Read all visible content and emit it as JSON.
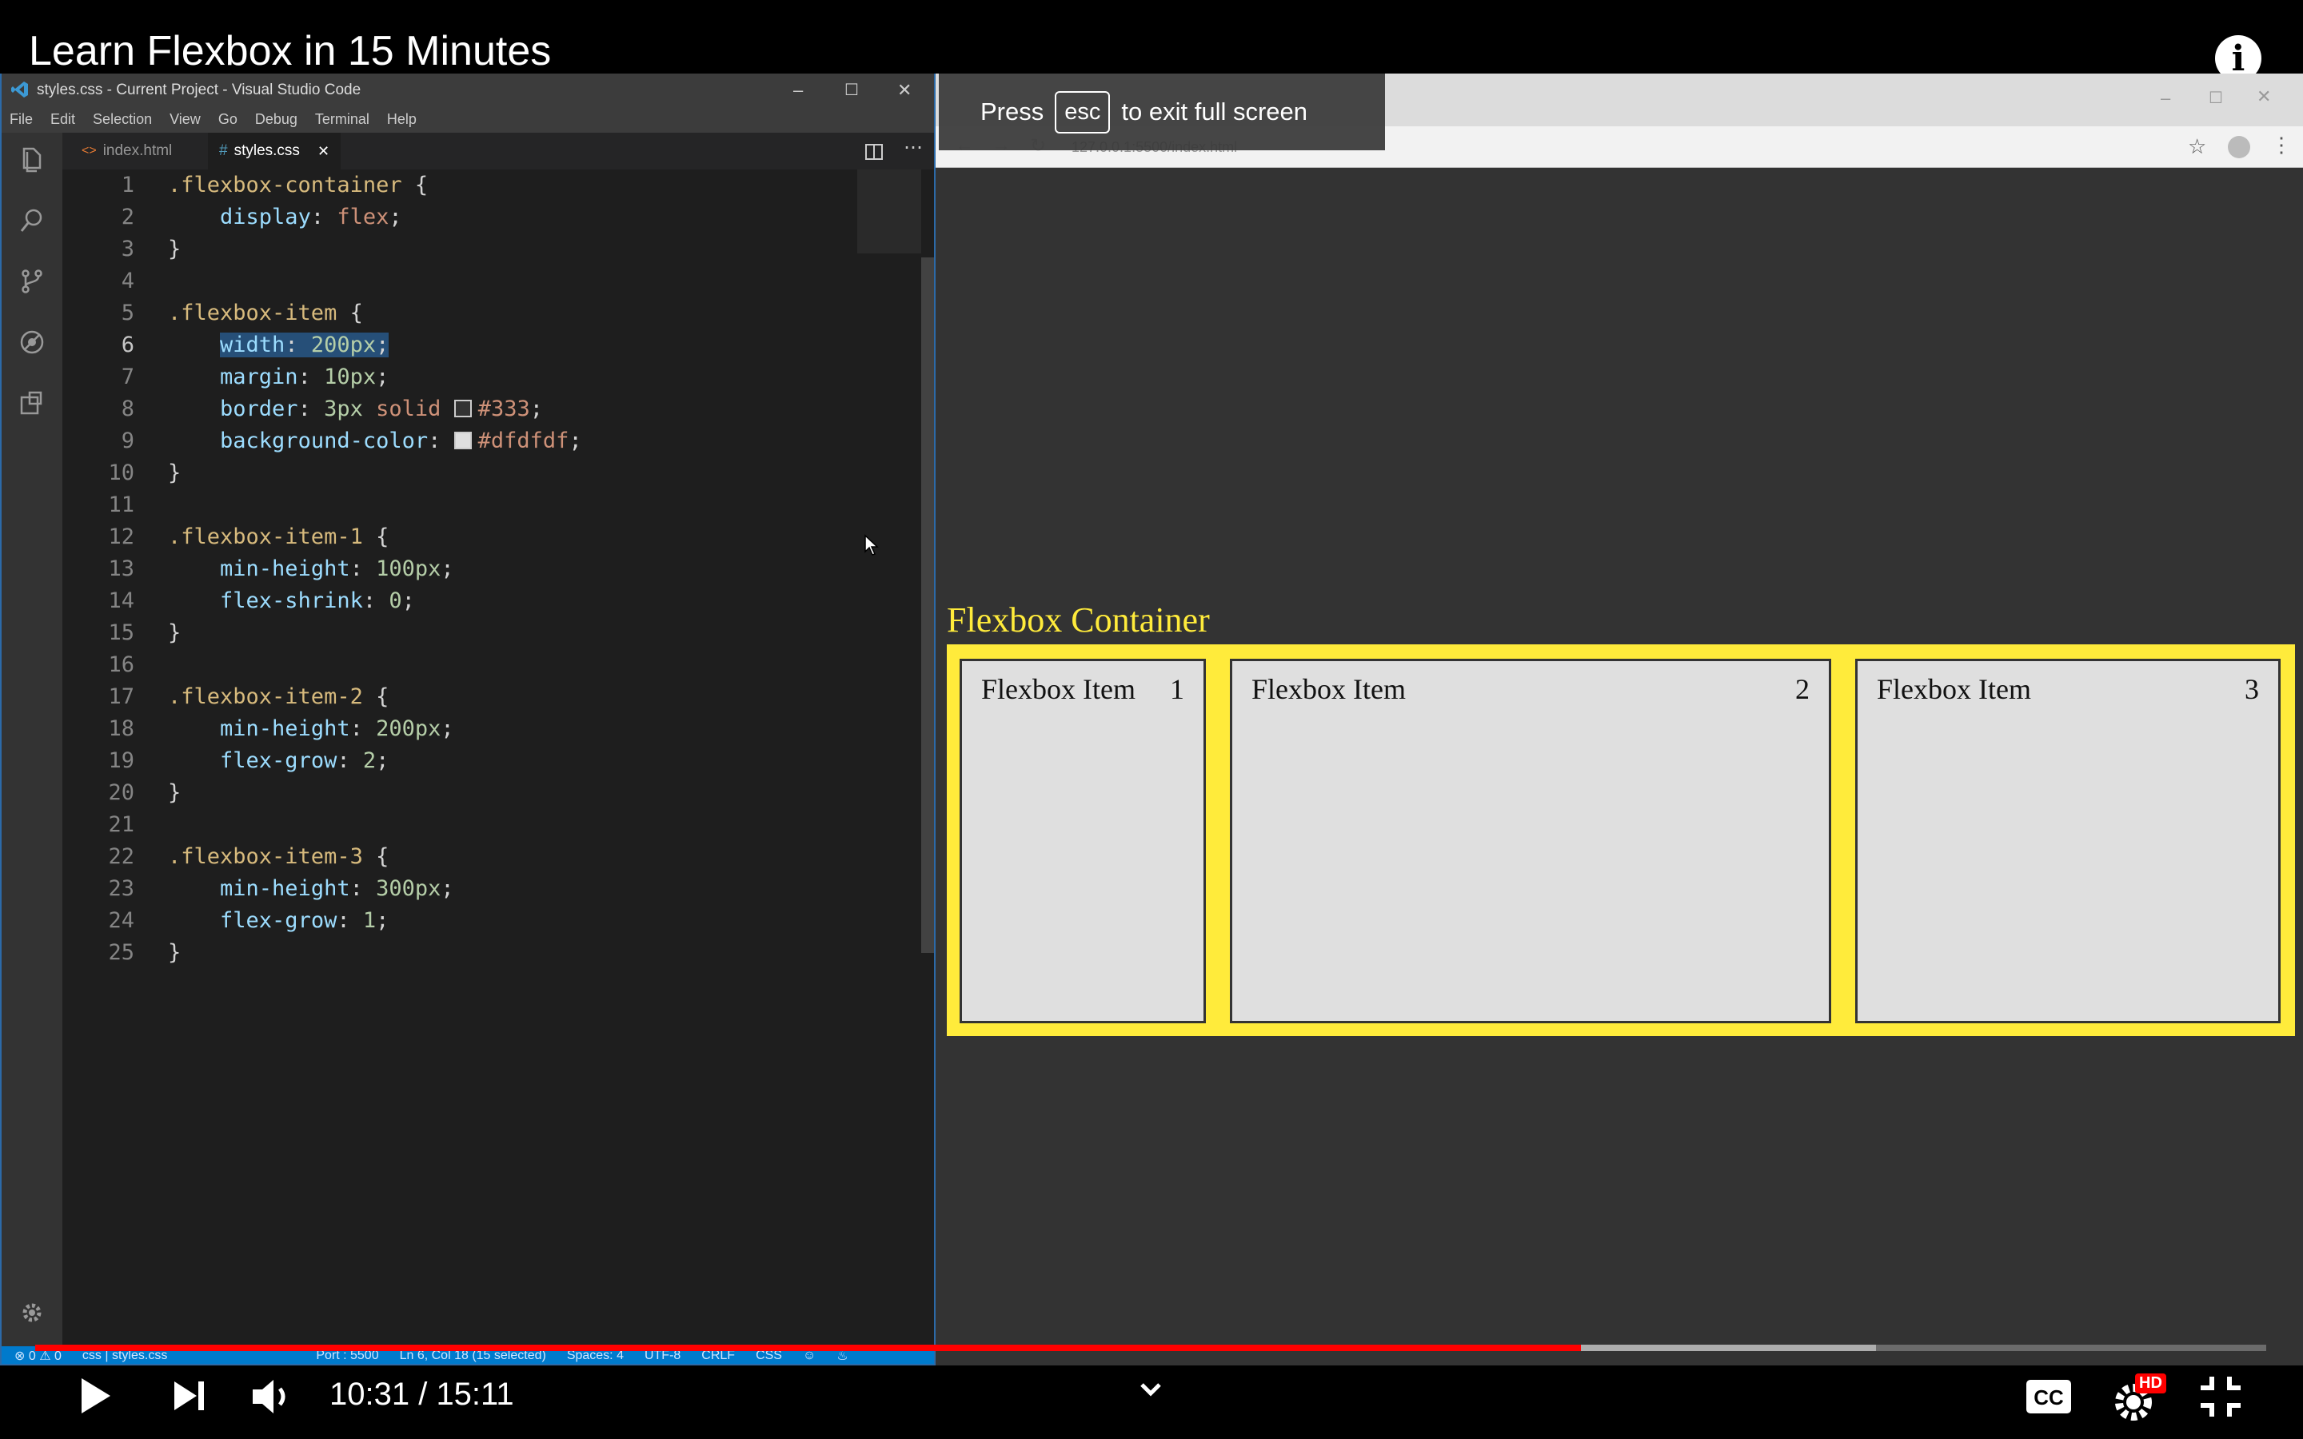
{
  "video": {
    "title": "Learn Flexbox in 15 Minutes",
    "time_display": "10:31 / 15:11",
    "progress_fraction": 0.6929,
    "buffered_fraction": 0.825,
    "info_label": "i",
    "hd_badge": "HD"
  },
  "fullscreen_toast": {
    "press": "Press",
    "key": "esc",
    "rest": "to exit full screen"
  },
  "vscode": {
    "window_title": "styles.css - Current Project - Visual Studio Code",
    "menu": [
      "File",
      "Edit",
      "Selection",
      "View",
      "Go",
      "Debug",
      "Terminal",
      "Help"
    ],
    "tabs": [
      {
        "label": "index.html",
        "icon": "<>"
      },
      {
        "label": "styles.css",
        "icon": "#"
      }
    ],
    "status": {
      "errors": "0",
      "warnings": "0",
      "branch": "css | styles.css",
      "port": "Port : 5500",
      "cursor": "Ln 6, Col 18 (15 selected)",
      "spaces": "Spaces: 4",
      "encoding": "UTF-8",
      "eol": "CRLF",
      "lang": "CSS"
    },
    "code": [
      {
        "n": "1",
        "t": ".flexbox-container {"
      },
      {
        "n": "2",
        "t": "    display: flex;"
      },
      {
        "n": "3",
        "t": "}"
      },
      {
        "n": "4",
        "t": ""
      },
      {
        "n": "5",
        "t": ".flexbox-item {"
      },
      {
        "n": "6",
        "t": "    width: 200px;"
      },
      {
        "n": "7",
        "t": "    margin: 10px;"
      },
      {
        "n": "8",
        "t": "    border: 3px solid #333;"
      },
      {
        "n": "9",
        "t": "    background-color: #dfdfdf;"
      },
      {
        "n": "10",
        "t": "}"
      },
      {
        "n": "11",
        "t": ""
      },
      {
        "n": "12",
        "t": ".flexbox-item-1 {"
      },
      {
        "n": "13",
        "t": "    min-height: 100px;"
      },
      {
        "n": "14",
        "t": "    flex-shrink: 0;"
      },
      {
        "n": "15",
        "t": "}"
      },
      {
        "n": "16",
        "t": ""
      },
      {
        "n": "17",
        "t": ".flexbox-item-2 {"
      },
      {
        "n": "18",
        "t": "    min-height: 200px;"
      },
      {
        "n": "19",
        "t": "    flex-grow: 2;"
      },
      {
        "n": "20",
        "t": "}"
      },
      {
        "n": "21",
        "t": ""
      },
      {
        "n": "22",
        "t": ".flexbox-item-3 {"
      },
      {
        "n": "23",
        "t": "    min-height: 300px;"
      },
      {
        "n": "24",
        "t": "    flex-grow: 1;"
      },
      {
        "n": "25",
        "t": "}"
      }
    ]
  },
  "browser": {
    "url": "127.0.0.1:5500/index.html",
    "container_title": "Flexbox Container",
    "items": [
      {
        "label": "Flexbox Item",
        "num": "1"
      },
      {
        "label": "Flexbox Item",
        "num": "2"
      },
      {
        "label": "Flexbox Item",
        "num": "3"
      }
    ]
  },
  "colors": {
    "accent_yellow": "#ffeb3b",
    "progress_red": "#ff0000",
    "vscode_blue": "#007acc"
  }
}
